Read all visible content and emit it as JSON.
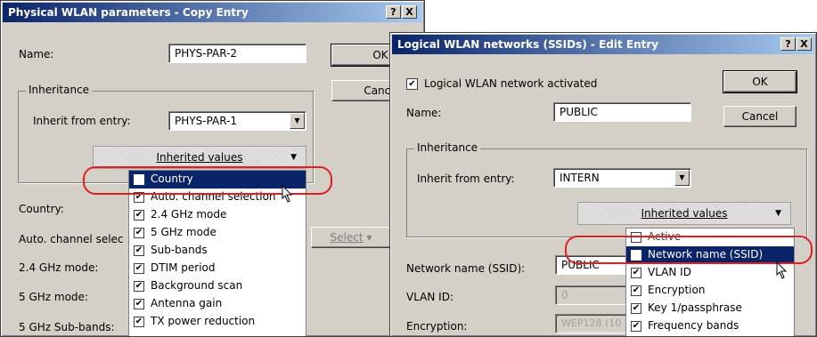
{
  "d1": {
    "title": "Physical WLAN parameters - Copy Entry",
    "help": "?",
    "close": "X",
    "name_label": "Name:",
    "name_value": "PHYS-PAR-2",
    "ok": "OK",
    "cancel": "Cance",
    "inheritance": "Inheritance",
    "inherit_from_label": "Inherit from entry:",
    "inherit_from_value": "PHYS-PAR-1",
    "inherited_values": "Inherited values",
    "select_button": "Select",
    "labels": [
      "Country:",
      "Auto. channel selec",
      "2.4 GHz mode:",
      "5 GHz mode:",
      "5 GHz Sub-bands:"
    ],
    "menu": [
      {
        "label": "Country",
        "checked": false
      },
      {
        "label": "Auto. channel selection",
        "checked": true
      },
      {
        "label": "2.4 GHz mode",
        "checked": true
      },
      {
        "label": "5 GHz mode",
        "checked": true
      },
      {
        "label": "Sub-bands",
        "checked": true
      },
      {
        "label": "DTIM period",
        "checked": true
      },
      {
        "label": "Background scan",
        "checked": true
      },
      {
        "label": "Antenna gain",
        "checked": true
      },
      {
        "label": "TX power reduction",
        "checked": true
      }
    ]
  },
  "d2": {
    "title": "Logical WLAN networks (SSIDs) - Edit Entry",
    "help": "?",
    "close": "X",
    "activated_label": "Logical WLAN network activated",
    "activated_checked": true,
    "ok": "OK",
    "cancel": "Cancel",
    "name_label": "Name:",
    "name_value": "PUBLIC",
    "inheritance": "Inheritance",
    "inherit_from_label": "Inherit from entry:",
    "inherit_from_value": "INTERN",
    "inherited_values": "Inherited values",
    "ssid_label": "Network name (SSID):",
    "ssid_value": "PUBLIC",
    "vlan_label": "VLAN ID:",
    "vlan_value": "0",
    "enc_label": "Encryption:",
    "enc_value": "WEP128 (10",
    "menu": [
      {
        "label": "Active",
        "checked": false
      },
      {
        "label": "Network name (SSID)",
        "checked": false
      },
      {
        "label": "VLAN ID",
        "checked": true
      },
      {
        "label": "Encryption",
        "checked": true
      },
      {
        "label": "Key 1/passphrase",
        "checked": true
      },
      {
        "label": "Frequency bands",
        "checked": true
      }
    ]
  },
  "check_glyph": "✔",
  "colors": {
    "highlight": "#e31e1e",
    "titlebar": "#0a246a",
    "selection": "#0a246a"
  }
}
